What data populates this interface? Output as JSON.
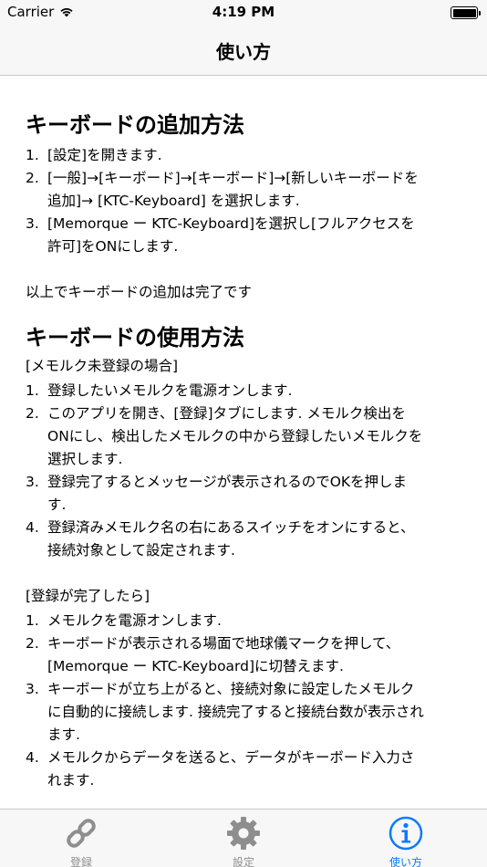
{
  "status_bar": {
    "carrier": "Carrier",
    "time": "4:19 PM"
  },
  "nav": {
    "title": "使い方"
  },
  "section1": {
    "title": "キーボードの追加方法",
    "items": [
      {
        "num": "1.",
        "text": "[設定]を開きます."
      },
      {
        "num": "2.",
        "text": "[一般]→[キーボード]→[キーボード]→[新しいキーボードを\n追加]→ [KTC-Keyboard] を選択します."
      },
      {
        "num": "3.",
        "text": "[Memorque ー KTC-Keyboard]を選択し[フルアクセスを\n許可]をONにします."
      }
    ],
    "note": "以上でキーボードの追加は完了です"
  },
  "section2": {
    "title": "キーボードの使用方法",
    "subsection1": {
      "heading": "[メモルク未登録の場合]",
      "items": [
        {
          "num": "1.",
          "text": "登録したいメモルクを電源オンします."
        },
        {
          "num": "2.",
          "text": "このアプリを開き、[登録]タブにします. メモルク検出を\nONにし、検出したメモルクの中から登録したいメモルクを\n選択します."
        },
        {
          "num": "3.",
          "text": "登録完了するとメッセージが表示されるのでOKを押しま\nす."
        },
        {
          "num": "4.",
          "text": "登録済みメモルク名の右にあるスイッチをオンにすると、\n接続対象として設定されます."
        }
      ]
    },
    "subsection2": {
      "heading": "[登録が完了したら]",
      "items": [
        {
          "num": "1.",
          "text": "メモルクを電源オンします."
        },
        {
          "num": "2.",
          "text": "キーボードが表示される場面で地球儀マークを押して、\n[Memorque ー KTC-Keyboard]に切替えます."
        },
        {
          "num": "3.",
          "text": "キーボードが立ち上がると、接続対象に設定したメモルク\nに自動的に接続します. 接続完了すると接続台数が表示され\nます."
        },
        {
          "num": "4.",
          "text": "メモルクからデータを送ると、データがキーボード入力さ\nれます."
        }
      ]
    }
  },
  "tabs": [
    {
      "label": "登録",
      "icon": "link-icon",
      "active": false
    },
    {
      "label": "設定",
      "icon": "gear-icon",
      "active": false
    },
    {
      "label": "使い方",
      "icon": "info-icon",
      "active": true
    }
  ],
  "colors": {
    "accent": "#0a7aff",
    "inactive": "#8e8e8e",
    "bar_bg": "#f7f7f7"
  }
}
